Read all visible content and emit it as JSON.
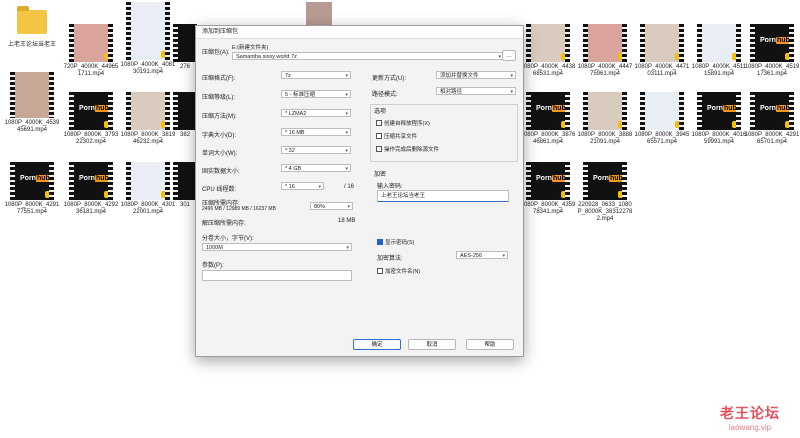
{
  "desktop": {
    "folder_label": "上老王论坛当老王",
    "brand": "Porn",
    "brand_hub": "hub",
    "files": [
      "720P_4000K_449651711.mp4",
      "1080P_4000K_408130191.mp4",
      "276",
      "1080P_4000K_443868531.mp4",
      "1080P_4000K_444775961.mp4",
      "1080P_4000K_447103111.mp4",
      "1080P_4000K_451115891.mp4",
      "1080P_4000K_451917361.mp4",
      "1080P_4000K_453945691.mp4",
      "1080P_8000K_379322302.mp4",
      "1080P_8000K_381946232.mp4",
      "382",
      "1080P_8000K_387646861.mp4",
      "1080P_8000K_388821091.mp4",
      "1080P_8000K_394565571.mp4",
      "1080P_8000K_401659991.mp4",
      "1080P_8000K_429165701.mp4",
      "1080P_8000K_429177551.mp4",
      "1080P_8000K_429236181.mp4",
      "1080P_8000K_430122001.mp4",
      "301",
      "1080P_8000K_435978341.mp4",
      "220928_0633_1080P_8000K_383122782.mp4"
    ]
  },
  "dialog": {
    "title": "添加到压缩包",
    "archive_label": "压缩包(A):",
    "path_hint": "E:(新建文件夹)",
    "archive_name": "Samantha sissy world 7z",
    "browse": "...",
    "format_label": "压缩格式(F):",
    "format_value": "7z",
    "level_label": "压缩等级(L):",
    "level_value": "5 - 标准压缩",
    "method_label": "压缩方法(M):",
    "method_value": "* LZMA2",
    "dict_label": "字典大小(D):",
    "dict_value": "* 16 MB",
    "word_label": "单词大小(W):",
    "word_value": "* 32",
    "solid_label": "固实数据大小:",
    "solid_value": "* 4 GB",
    "cpu_label": "CPU 线程数:",
    "cpu_value": "* 16",
    "cpu_total": "/ 16",
    "mem_label": "压缩所需内存:",
    "mem_value": "2496 MB / 12989 MB / 16237 MB",
    "mem_percent": "80%",
    "decomp_label": "解压缩所需内存:",
    "decomp_value": "18 MB",
    "split_label": "分卷大小，字节(V):",
    "split_value": "1000M",
    "params_label": "参数(P):",
    "update_label": "更新方式(U):",
    "update_value": "添加并替换文件",
    "path_mode_label": "路径模式:",
    "path_mode_value": "相对路径",
    "options_title": "选项",
    "opt_sfx": "创建自释放程序(X)",
    "opt_shared": "压缩共享文件",
    "opt_delete": "操作完成后删除源文件",
    "enc_title": "加密",
    "pwd_label": "输入密码:",
    "pwd_value": "上老王论坛当老王",
    "show_pwd": "显示密码(S)",
    "enc_method_label": "加密算法:",
    "enc_method_value": "AES-256",
    "enc_names": "加密文件名(N)",
    "ok": "确定",
    "cancel": "取消",
    "help": "帮助"
  },
  "watermark": {
    "line1": "老王论坛",
    "line2": "laowang.vip"
  }
}
